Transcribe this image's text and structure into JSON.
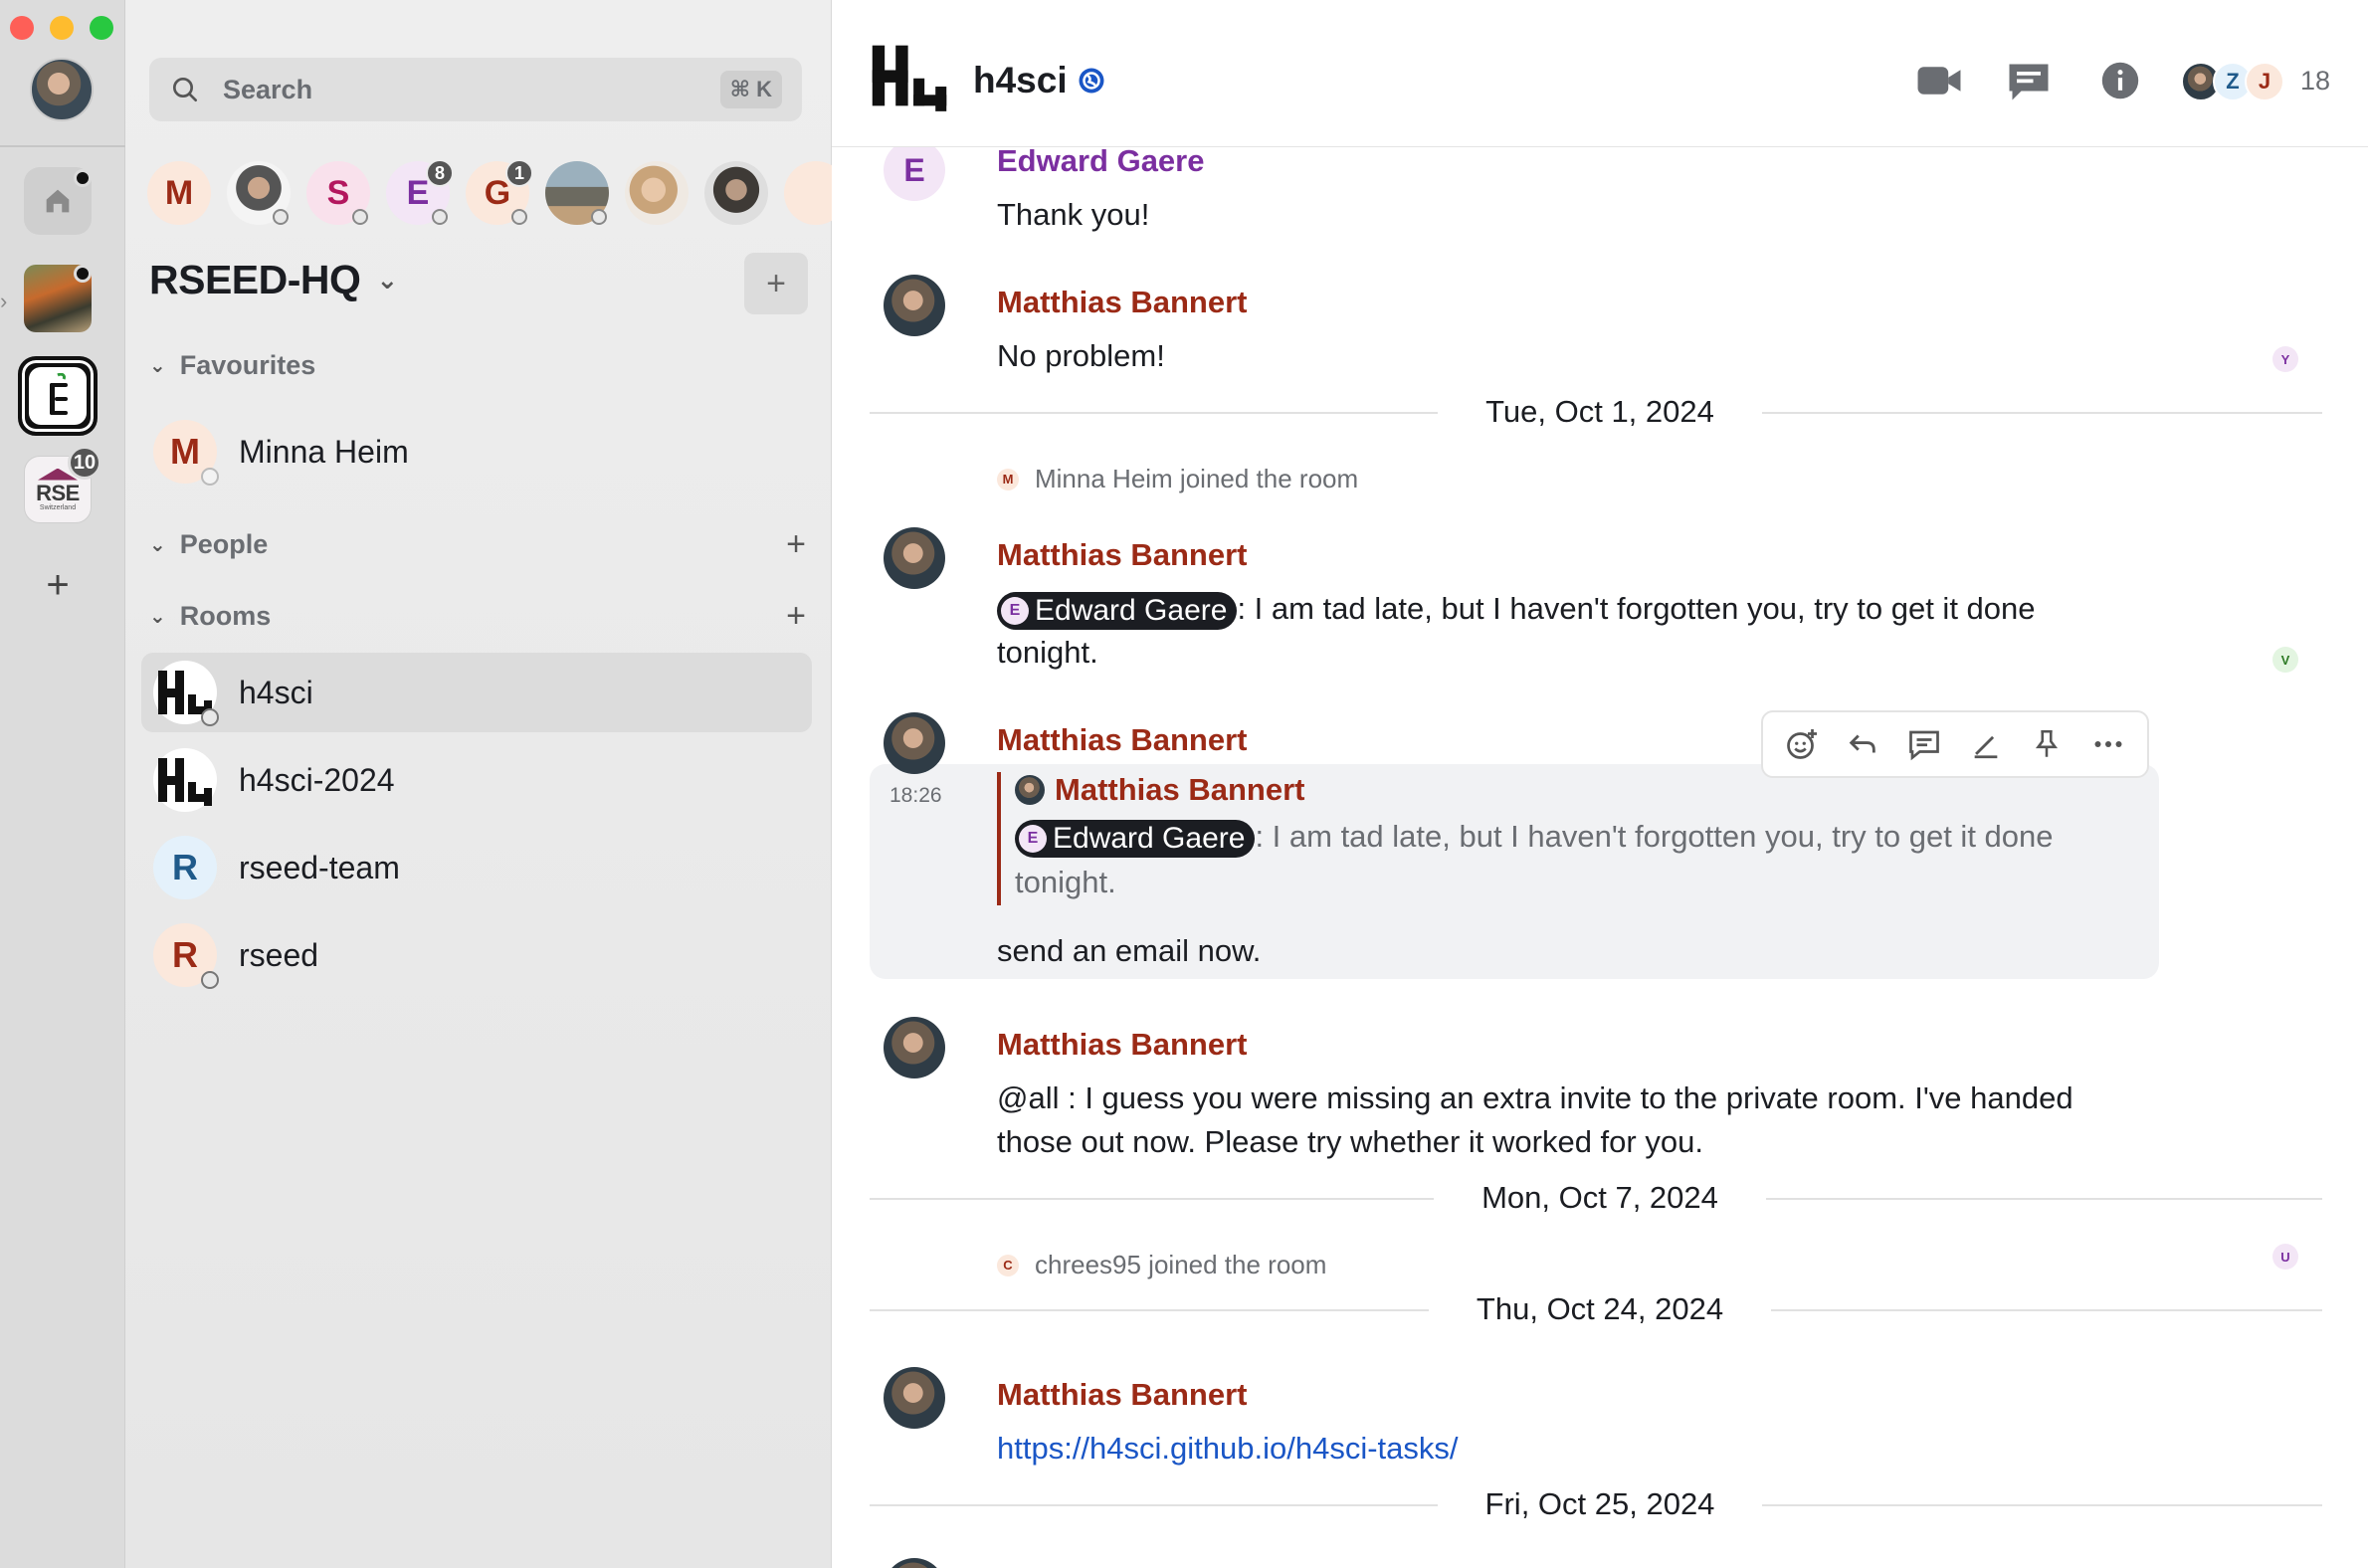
{
  "search": {
    "placeholder": "Search",
    "shortcut": "⌘ K"
  },
  "spacebar": {
    "items": [
      {
        "name": "Home",
        "icon": "home-icon"
      },
      {
        "name": "space-photo",
        "icon": "space-image"
      },
      {
        "name": "h4sci",
        "icon": "h4sci-space-icon",
        "active": true
      },
      {
        "name": "RSE Switzerland",
        "icon": "rse-logo",
        "badge": "10"
      }
    ],
    "rse_logo_text": "RSE",
    "rse_logo_sub": "Switzerland"
  },
  "breadcrumbs": [
    {
      "letter": "M",
      "color": "#9b2a16",
      "bg": "#fbe8dc"
    },
    {
      "letter": "",
      "photo": true
    },
    {
      "letter": "S",
      "color": "#b3175e",
      "bg": "#f9e1ec"
    },
    {
      "letter": "E",
      "color": "#7b2fa0",
      "bg": "#f3e6f6",
      "count": "8"
    },
    {
      "letter": "G",
      "color": "#9b2a16",
      "bg": "#fbe8dc",
      "count": "1"
    },
    {
      "letter": "",
      "photo": true
    },
    {
      "letter": "",
      "photo": true
    },
    {
      "letter": "",
      "photo": true
    }
  ],
  "space": {
    "title": "RSEED-HQ"
  },
  "sections": {
    "favourites": "Favourites",
    "people": "People",
    "rooms": "Rooms"
  },
  "favourites": [
    {
      "name": "Minna Heim",
      "letter": "M"
    }
  ],
  "rooms": [
    {
      "name": "h4sci",
      "active": true
    },
    {
      "name": "h4sci-2024"
    },
    {
      "name": "rseed-team",
      "letter": "R"
    },
    {
      "name": "rseed",
      "letter": "R"
    }
  ],
  "header": {
    "room_name": "h4sci",
    "member_count": "18",
    "member_letters": [
      "Z",
      "J"
    ]
  },
  "timeline": {
    "m1": {
      "sender": "Edward Gaere",
      "avatar_letter": "E",
      "body": "Thank you!"
    },
    "m2": {
      "sender": "Matthias Bannert",
      "body": "No problem!",
      "receipt": "Y"
    },
    "d1": "Tue, Oct 1, 2024",
    "e1": {
      "mini": "M",
      "text": "Minna Heim joined the room"
    },
    "m3": {
      "sender": "Matthias Bannert",
      "mention": "Edward Gaere",
      "mention_letter": "E",
      "body": ": I am tad late, but I haven't forgotten you, try to get it done tonight.",
      "receipt": "V"
    },
    "m4": {
      "sender": "Matthias Bannert",
      "time": "18:26",
      "quote_sender": "Matthias Bannert",
      "quote_mention": "Edward Gaere",
      "quote_mention_letter": "E",
      "quote_body": ": I am tad late, but I haven't forgotten you, try to get it done tonight.",
      "body": "send an email now."
    },
    "m5": {
      "sender": "Matthias Bannert",
      "body": "@all : I guess you were missing an extra invite to the private room. I've handed those out now. Please try whether it worked for you."
    },
    "d2": "Mon, Oct 7, 2024",
    "e2": {
      "mini": "C",
      "text": "chrees95 joined the room",
      "receipt": "U"
    },
    "d3": "Thu, Oct 24, 2024",
    "m6": {
      "sender": "Matthias Bannert",
      "link": "https://h4sci.github.io/h4sci-tasks/"
    },
    "d4": "Fri, Oct 25, 2024"
  },
  "toolbar": [
    "react-icon",
    "reply-icon",
    "thread-icon",
    "edit-icon",
    "pin-icon",
    "more-options-icon"
  ],
  "colors": {
    "accent_sender": "#9b2a16",
    "edward_purple": "#7b2fa0",
    "link_blue": "#1a56c6"
  }
}
